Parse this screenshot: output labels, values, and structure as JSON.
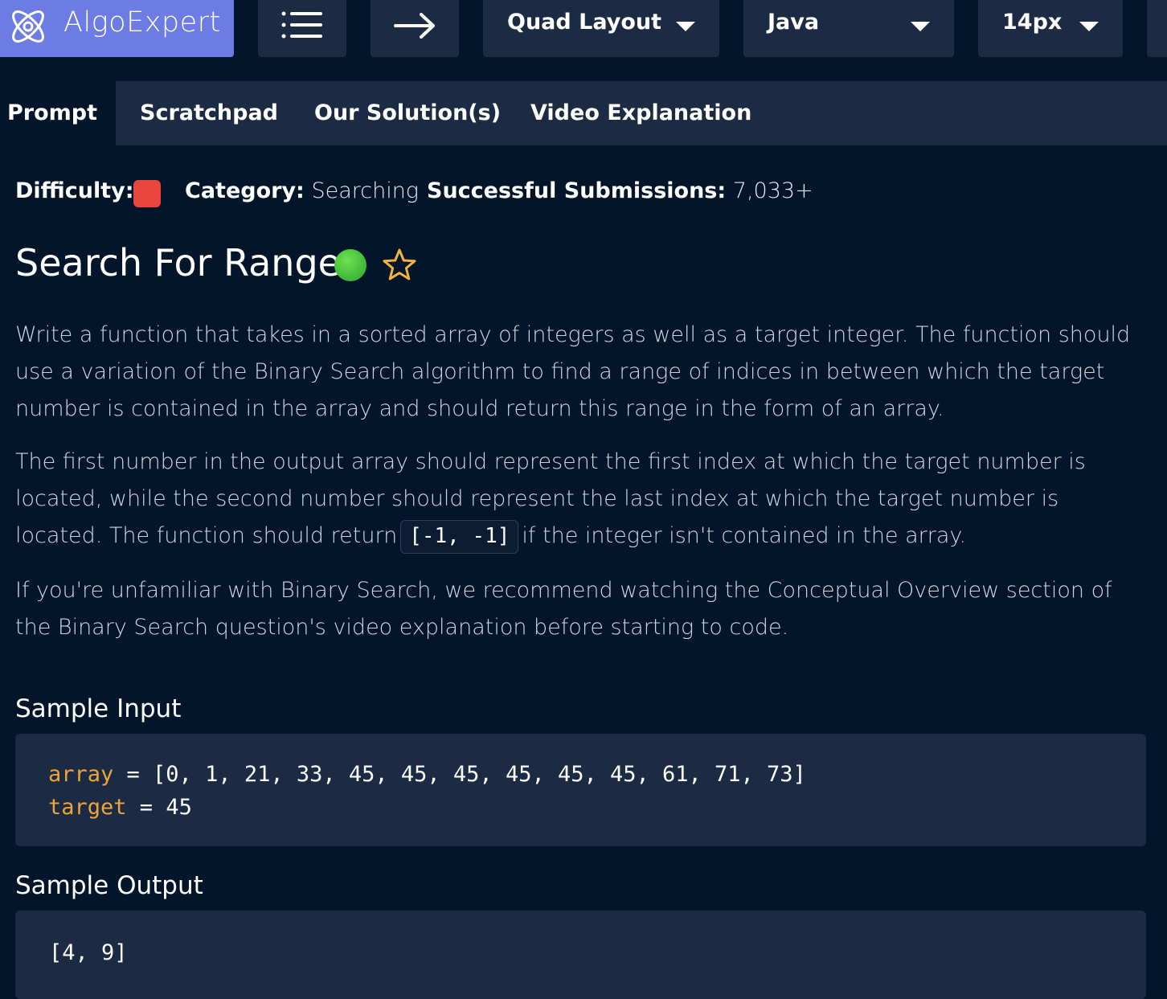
{
  "brand": {
    "name": "AlgoExpert",
    "color": "#6d7be5"
  },
  "toolbar": {
    "menu_icon": "menu-list-icon",
    "arrow_icon": "arrow-right-icon",
    "layout_label": "Quad Layout",
    "language_label": "Java",
    "font_size_label": "14px"
  },
  "tabs": [
    {
      "label": "Prompt",
      "active": true
    },
    {
      "label": "Scratchpad",
      "active": false
    },
    {
      "label": "Our Solution(s)",
      "active": false
    },
    {
      "label": "Video Explanation",
      "active": false
    }
  ],
  "meta": {
    "difficulty_label": "Difficulty:",
    "difficulty_color": "#e8453c",
    "category_label": "Category:",
    "category_value": "Searching",
    "submissions_label": "Successful Submissions:",
    "submissions_value": "7,033+"
  },
  "question": {
    "title": "Search For Range",
    "status_color": "#4cc33f",
    "star_icon": "star-outline-icon",
    "paragraphs": {
      "p1": "Write a function that takes in a sorted array of integers as well as a target integer. The function should use a variation of the Binary Search algorithm to find a range of indices in between which the target number is contained in the array and should return this range in the form of an array.",
      "p2_before": "The first number in the output array should represent the first index at which the target number is located, while the second number should represent the last index at which the target number is located. The function should return",
      "p2_code": "[-1, -1]",
      "p2_after": "if the integer isn't contained in the array.",
      "p3": "If you're unfamiliar with Binary Search, we recommend watching the Conceptual Overview section of the Binary Search question's video explanation before starting to code."
    }
  },
  "sample_input": {
    "heading": "Sample Input",
    "lines": [
      {
        "var": "array",
        "rest": " = [0, 1, 21, 33, 45, 45, 45, 45, 45, 45, 61, 71, 73]"
      },
      {
        "var": "target",
        "rest": " = 45"
      }
    ]
  },
  "sample_output": {
    "heading": "Sample Output",
    "value": "[4, 9]"
  }
}
